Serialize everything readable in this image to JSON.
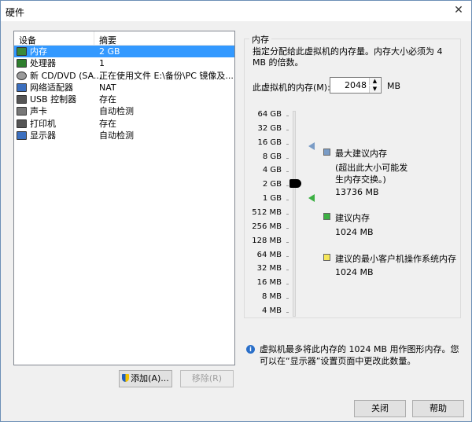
{
  "window": {
    "title": "硬件",
    "close_glyph": "✕"
  },
  "device_list": {
    "col_device": "设备",
    "col_summary": "摘要",
    "rows": [
      {
        "name": "内存",
        "summary": "2 GB",
        "icon": "memory-icon",
        "selected": true
      },
      {
        "name": "处理器",
        "summary": "1",
        "icon": "processor-icon"
      },
      {
        "name": "新 CD/DVD (SA...",
        "summary": "正在使用文件 E:\\备份\\PC 镜像及...",
        "icon": "cd-dvd-icon"
      },
      {
        "name": "网络适配器",
        "summary": "NAT",
        "icon": "network-adapter-icon"
      },
      {
        "name": "USB 控制器",
        "summary": "存在",
        "icon": "usb-icon"
      },
      {
        "name": "声卡",
        "summary": "自动检测",
        "icon": "sound-card-icon"
      },
      {
        "name": "打印机",
        "summary": "存在",
        "icon": "printer-icon"
      },
      {
        "name": "显示器",
        "summary": "自动检测",
        "icon": "display-icon"
      }
    ],
    "add_button": "添加(A)...",
    "remove_button": "移除(R)"
  },
  "memory": {
    "group_label": "内存",
    "description": "指定分配给此虚拟机的内存量。内存大小必须为 4 MB 的倍数。",
    "field_label": "此虚拟机的内存(M):",
    "value": "2048",
    "unit": "MB",
    "scale": [
      "64 GB",
      "32 GB",
      "16 GB",
      "8 GB",
      "4 GB",
      "2 GB",
      "1 GB",
      "512 MB",
      "256 MB",
      "128 MB",
      "64 MB",
      "32 MB",
      "16 MB",
      "8 MB",
      "4 MB"
    ],
    "max_recommended_label": "最大建议内存",
    "max_recommended_note": "(超出此大小可能发生内存交换。)",
    "max_recommended_value": "13736 MB",
    "recommended_label": "建议内存",
    "recommended_value": "1024 MB",
    "min_guest_label": "建议的最小客户机操作系统内存",
    "min_guest_value": "1024 MB",
    "colors": {
      "max": "#7a9cc6",
      "recommended": "#3cb043",
      "min_guest": "#f5e65a"
    }
  },
  "info": {
    "text": "虚拟机最多将此内存的 1024 MB 用作图形内存。您可以在“显示器”设置页面中更改此数量。"
  },
  "footer": {
    "close_button": "关闭",
    "help_button": "帮助"
  }
}
